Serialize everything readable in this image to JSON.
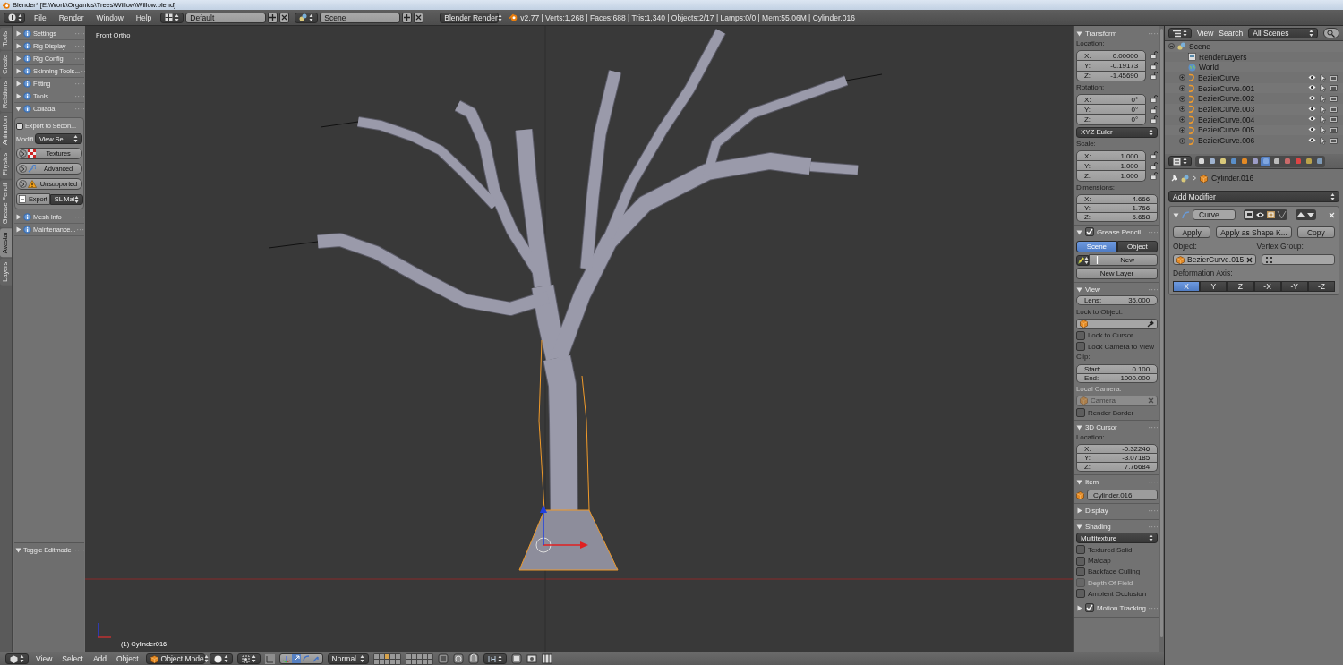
{
  "title_bar": {
    "title": "Blender* [E:\\Work\\Organics\\Trees\\Willow\\Willow.blend]"
  },
  "info_header": {
    "menus": [
      "File",
      "Render",
      "Window",
      "Help"
    ],
    "screen_layout": "Default",
    "scene": "Scene",
    "render_engine": "Blender Render",
    "stats": "v2.77 | Verts:1,268 | Faces:688 | Tris:1,340 | Objects:2/17 | Lamps:0/0 | Mem:55.06M | Cylinder.016"
  },
  "tool_tabs": [
    {
      "label": "Tools",
      "selected": false
    },
    {
      "label": "Create",
      "selected": false
    },
    {
      "label": "Relations",
      "selected": false
    },
    {
      "label": "Animation",
      "selected": false
    },
    {
      "label": "Physics",
      "selected": false
    },
    {
      "label": "Grease Pencil",
      "selected": false
    },
    {
      "label": "Avastar",
      "selected": true
    },
    {
      "label": "Layers",
      "selected": false
    }
  ],
  "tool_shelf": {
    "panels": [
      {
        "label": "Settings",
        "expanded": false
      },
      {
        "label": "Rig Display",
        "expanded": false
      },
      {
        "label": "Rig Config",
        "expanded": false
      },
      {
        "label": "Skinning Tools...",
        "expanded": false
      },
      {
        "label": "Fitting",
        "expanded": false
      },
      {
        "label": "Tools",
        "expanded": false
      },
      {
        "label": "Collada",
        "expanded": true,
        "content": {
          "export_option": {
            "label": "Export to Secon...",
            "checked": false
          },
          "modifier_label": "Modifi",
          "modifier_value": "View Se",
          "subpanels": [
            {
              "label": "Textures",
              "kind": "checker"
            },
            {
              "label": "Advanced",
              "kind": "wrench"
            },
            {
              "label": "Unsupported",
              "kind": "warning"
            }
          ],
          "export_button": "Export",
          "export_target": "SL Mai"
        }
      },
      {
        "label": "Mesh Info",
        "expanded": false
      },
      {
        "label": "Maintenance...",
        "expanded": false
      }
    ],
    "operator_panel": {
      "label": "Toggle Editmode",
      "expanded": true
    }
  },
  "viewport": {
    "view_name": "Front Ortho",
    "object_info": "(1) Cylinder016"
  },
  "properties_region": {
    "sections": [
      {
        "title": "Transform",
        "expanded": true,
        "rows": [
          {
            "kind": "label",
            "text": "Location:",
            "disabled": false
          },
          {
            "kind": "vector",
            "lockable": true,
            "fields": [
              {
                "label": "X:",
                "value": "0.00000"
              },
              {
                "label": "Y:",
                "value": "-0.19173"
              },
              {
                "label": "Z:",
                "value": "-1.45690"
              }
            ]
          },
          {
            "kind": "label",
            "text": "Rotation:",
            "disabled": false
          },
          {
            "kind": "vector",
            "lockable": true,
            "fields": [
              {
                "label": "X:",
                "value": "0°"
              },
              {
                "label": "Y:",
                "value": "0°"
              },
              {
                "label": "Z:",
                "value": "0°"
              }
            ]
          },
          {
            "kind": "dropdown",
            "value": "XYZ Euler"
          },
          {
            "kind": "label",
            "text": "Scale:",
            "disabled": false
          },
          {
            "kind": "vector",
            "lockable": true,
            "fields": [
              {
                "label": "X:",
                "value": "1.000"
              },
              {
                "label": "Y:",
                "value": "1.000"
              },
              {
                "label": "Z:",
                "value": "1.000"
              }
            ]
          },
          {
            "kind": "label",
            "text": "Dimensions:",
            "disabled": false
          },
          {
            "kind": "vector",
            "lockable": false,
            "fields": [
              {
                "label": "X:",
                "value": "4.666"
              },
              {
                "label": "Y:",
                "value": "1.766"
              },
              {
                "label": "Z:",
                "value": "5.658"
              }
            ]
          }
        ]
      },
      {
        "title": "Grease Pencil",
        "expanded": true,
        "enabled": true,
        "rows": [
          {
            "kind": "tabs",
            "items": [
              {
                "label": "Scene",
                "selected": true
              },
              {
                "label": "Object",
                "selected": false
              }
            ]
          },
          {
            "kind": "new_button",
            "label": "New"
          },
          {
            "kind": "button",
            "label": "New Layer"
          }
        ]
      },
      {
        "title": "View",
        "expanded": true,
        "rows": [
          {
            "kind": "vector",
            "lockable": false,
            "fields": [
              {
                "label": "Lens:",
                "value": "35.000"
              }
            ]
          },
          {
            "kind": "label",
            "text": "Lock to Object:",
            "disabled": false
          },
          {
            "kind": "object_field",
            "eyedropper": true,
            "clearable": false,
            "disabled": false
          },
          {
            "kind": "checkbox",
            "label": "Lock to Cursor",
            "checked": false,
            "disabled": false
          },
          {
            "kind": "checkbox",
            "label": "Lock Camera to View",
            "checked": false,
            "disabled": false
          },
          {
            "kind": "label",
            "text": "Clip:",
            "disabled": false
          },
          {
            "kind": "vector",
            "lockable": false,
            "fields": [
              {
                "label": "Start:",
                "value": "0.100"
              },
              {
                "label": "End:",
                "value": "1000.000"
              }
            ]
          },
          {
            "kind": "label",
            "text": "Local Camera:",
            "disabled": true
          },
          {
            "kind": "object_field",
            "value": "Camera",
            "eyedropper": false,
            "clearable": true,
            "disabled": true
          },
          {
            "kind": "checkbox",
            "label": "Render Border",
            "checked": false,
            "disabled": false
          }
        ]
      },
      {
        "title": "3D Cursor",
        "expanded": true,
        "rows": [
          {
            "kind": "label",
            "text": "Location:",
            "disabled": false
          },
          {
            "kind": "vector",
            "lockable": false,
            "fields": [
              {
                "label": "X:",
                "value": "-0.32246"
              },
              {
                "label": "Y:",
                "value": "-3.07185"
              },
              {
                "label": "Z:",
                "value": "7.76684"
              }
            ]
          }
        ]
      },
      {
        "title": "Item",
        "expanded": true,
        "rows": [
          {
            "kind": "name_field",
            "value": "Cylinder.016"
          }
        ]
      },
      {
        "title": "Display",
        "expanded": false
      },
      {
        "title": "Shading",
        "expanded": true,
        "rows": [
          {
            "kind": "dropdown",
            "value": "Multitexture"
          },
          {
            "kind": "checkbox",
            "label": "Textured Solid",
            "checked": false,
            "disabled": false
          },
          {
            "kind": "checkbox",
            "label": "Matcap",
            "checked": false,
            "disabled": false
          },
          {
            "kind": "checkbox",
            "label": "Backface Culling",
            "checked": false,
            "disabled": false
          },
          {
            "kind": "checkbox",
            "label": "Depth Of Field",
            "checked": false,
            "disabled": true
          },
          {
            "kind": "checkbox",
            "label": "Ambient Occlusion",
            "checked": false,
            "disabled": false
          }
        ]
      },
      {
        "title": "Motion Tracking",
        "expanded": false,
        "enabled": true
      }
    ]
  },
  "outliner": {
    "menus": [
      "View",
      "Search"
    ],
    "filter": "All Scenes",
    "tree": [
      {
        "label": "Scene",
        "kind": "scene",
        "expanded": true,
        "children": [
          {
            "label": "RenderLayers",
            "kind": "render_layers"
          },
          {
            "label": "World",
            "kind": "world"
          },
          {
            "label": "BezierCurve",
            "kind": "curve"
          },
          {
            "label": "BezierCurve.001",
            "kind": "curve"
          },
          {
            "label": "BezierCurve.002",
            "kind": "curve"
          },
          {
            "label": "BezierCurve.003",
            "kind": "curve"
          },
          {
            "label": "BezierCurve.004",
            "kind": "curve"
          },
          {
            "label": "BezierCurve.005",
            "kind": "curve"
          },
          {
            "label": "BezierCurve.006",
            "kind": "curve"
          }
        ]
      }
    ]
  },
  "properties": {
    "tabs": [
      {
        "selected": false
      },
      {
        "selected": false
      },
      {
        "selected": false
      },
      {
        "selected": false
      },
      {
        "selected": false
      },
      {
        "selected": false
      },
      {
        "selected": true
      },
      {
        "selected": false
      },
      {
        "selected": false
      },
      {
        "selected": false
      },
      {
        "selected": false
      },
      {
        "selected": false
      }
    ],
    "context": "Cylinder.016",
    "add_modifier": "Add Modifier",
    "modifier": {
      "name": "Curve",
      "buttons": [
        "Apply",
        "Apply as Shape K...",
        "Copy"
      ],
      "object_label": "Object:",
      "object": "BezierCurve.015",
      "vertex_group_label": "Vertex Group:",
      "axis_label": "Deformation Axis:",
      "axes": [
        {
          "label": "X",
          "selected": true
        },
        {
          "label": "Y",
          "selected": false
        },
        {
          "label": "Z",
          "selected": false
        },
        {
          "label": "-X",
          "selected": false
        },
        {
          "label": "-Y",
          "selected": false
        },
        {
          "label": "-Z",
          "selected": false
        }
      ]
    }
  },
  "view_header": {
    "menus": [
      "View",
      "Select",
      "Add",
      "Object"
    ],
    "mode": "Object Mode",
    "orientation": "Normal"
  }
}
